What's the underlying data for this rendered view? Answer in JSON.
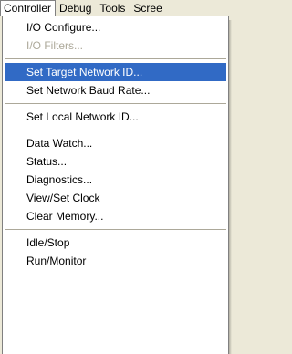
{
  "menubar": {
    "items": [
      {
        "label": "Controller"
      },
      {
        "label": "Debug"
      },
      {
        "label": "Tools"
      },
      {
        "label": "Scree"
      }
    ]
  },
  "menu": {
    "groups": [
      [
        {
          "label": "I/O Configure...",
          "state": "enabled"
        },
        {
          "label": "I/O Filters...",
          "state": "disabled"
        }
      ],
      [
        {
          "label": "Set Target Network ID...",
          "state": "highlighted"
        },
        {
          "label": "Set Network Baud Rate...",
          "state": "enabled"
        }
      ],
      [
        {
          "label": "Set Local Network ID...",
          "state": "enabled"
        }
      ],
      [
        {
          "label": "Data Watch...",
          "state": "enabled"
        },
        {
          "label": "Status...",
          "state": "enabled"
        },
        {
          "label": "Diagnostics...",
          "state": "enabled"
        },
        {
          "label": "View/Set Clock",
          "state": "enabled"
        },
        {
          "label": "Clear Memory...",
          "state": "enabled"
        }
      ],
      [
        {
          "label": "Idle/Stop",
          "state": "enabled"
        },
        {
          "label": "Run/Monitor",
          "state": "enabled"
        }
      ]
    ]
  },
  "colors": {
    "highlight_bg": "#316ac5",
    "highlight_fg": "#ffffff",
    "disabled_fg": "#aca899",
    "menubar_bg": "#ece9d8",
    "menu_bg": "#ffffff"
  }
}
